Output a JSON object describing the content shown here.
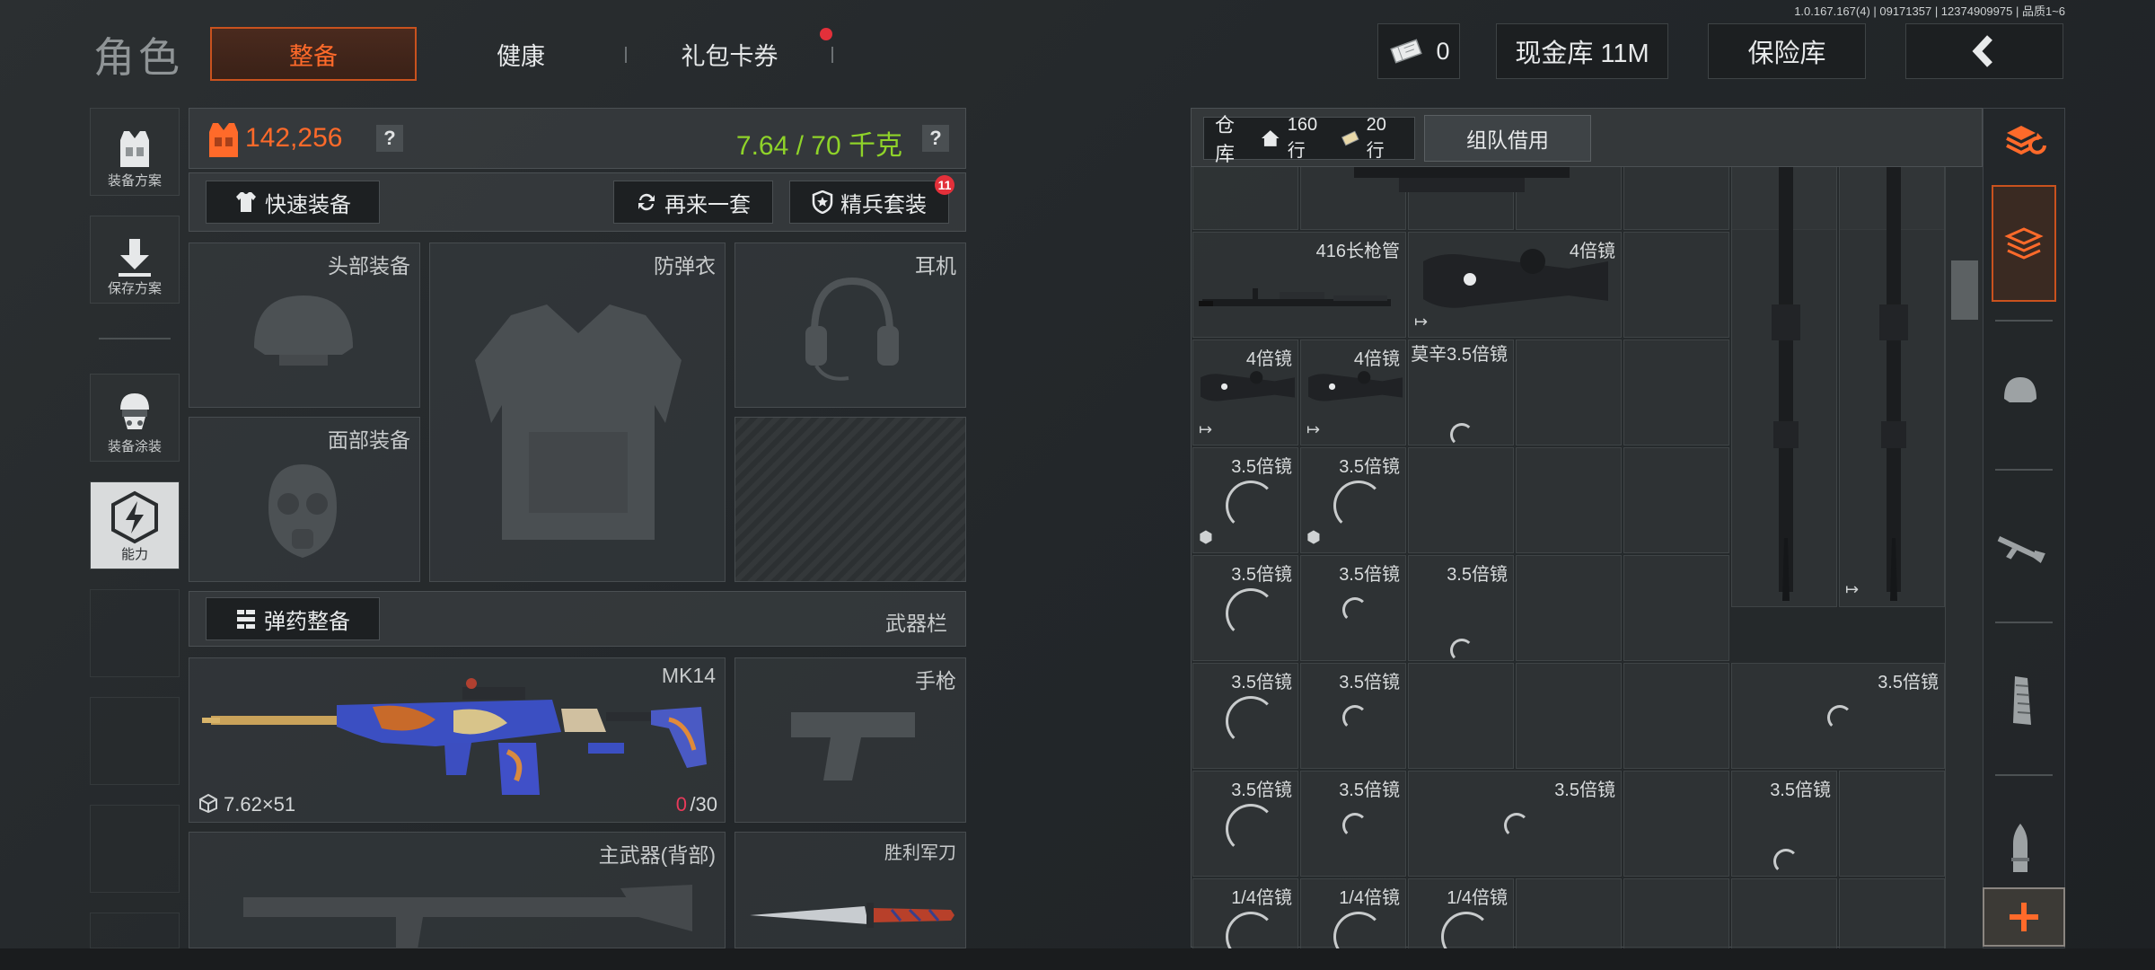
{
  "version": "1.0.167.167(4) | 09171357 | 12374909975 | 品质1~6",
  "header": {
    "title": "角色",
    "tabs": [
      {
        "label": "整备",
        "active": true
      },
      {
        "label": "健康",
        "active": false
      },
      {
        "label": "礼包卡券",
        "active": false,
        "badge_dot": true
      }
    ],
    "currency_count": "0",
    "cash_label": "现金库 11M",
    "safe_label": "保险库"
  },
  "sidebar": {
    "items": [
      {
        "label": "装备方案",
        "icon": "vest-icon"
      },
      {
        "label": "保存方案",
        "icon": "download-icon"
      },
      {
        "label": "装备涂装",
        "icon": "soldier-icon"
      },
      {
        "label": "能力",
        "icon": "lightning-hexagon-icon",
        "active": true
      }
    ]
  },
  "stats": {
    "value": "142,256",
    "weight": "7.64 / 70 千克",
    "help": "?"
  },
  "actions": {
    "quick_equip": "快速装备",
    "again": "再来一套",
    "elite": "精兵套装",
    "elite_badge": "11"
  },
  "slots": {
    "head": "头部装备",
    "armor": "防弹衣",
    "headset": "耳机",
    "face": "面部装备"
  },
  "ammo_bar": {
    "ammo_btn": "弹药整备",
    "weapon_bar": "武器栏"
  },
  "weapons": {
    "primary_name": "MK14",
    "caliber": "7.62×51",
    "ammo_current": "0",
    "ammo_max": "/30",
    "pistol": "手枪",
    "secondary": "主武器(背部)",
    "knife": "胜利军刀"
  },
  "warehouse": {
    "label": "仓库",
    "rows_total": "160行",
    "rows_extra": "20行",
    "team_btn": "组队借用",
    "items": {
      "barrel": "416长枪管",
      "scope4_a": "4倍镜",
      "scope4_b": "4倍镜",
      "scope4_c": "4倍镜",
      "mosin": "莫辛3.5倍镜",
      "s35_1": "3.5倍镜",
      "s35_2": "3.5倍镜",
      "s35_3": "3.5倍镜",
      "s35_4": "3.5倍镜",
      "s35_5": "3.5倍镜",
      "s35_6": "3.5倍镜",
      "s35_7": "3.5倍镜",
      "s35_8": "3.5倍镜",
      "s35_9": "3.5倍镜",
      "s35_10": "3.5倍镜",
      "s35_11": "3.5倍镜",
      "s35_12": "3.5倍镜",
      "q14_1": "1/4倍镜",
      "q14_2": "1/4倍镜",
      "q14_3": "1/4倍镜"
    }
  },
  "colors": {
    "accent": "#ff6a2a",
    "weight_green": "#8fd329",
    "badge_red": "#e3303a"
  }
}
